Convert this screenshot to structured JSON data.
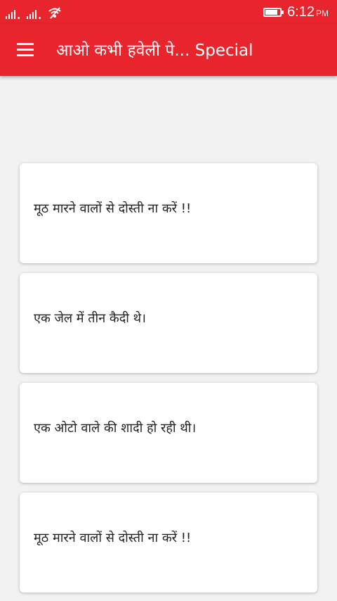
{
  "status_bar": {
    "time": "6:12",
    "ampm": "PM",
    "battery_level": 0.85,
    "icons": [
      "signal-icon",
      "signal-icon",
      "wifi-off-icon",
      "battery-icon"
    ]
  },
  "app_bar": {
    "title": "आओ कभी हवेली पे... Special",
    "background": "#e8242c",
    "menu_icon": "hamburger-menu-icon"
  },
  "cards": [
    {
      "text": "मूठ मारने वालों से दोस्ती ना करें !!"
    },
    {
      "text": "एक जेल में तीन कैदी थे।"
    },
    {
      "text": "एक ओटो वाले की शादी हो रही थी।"
    },
    {
      "text": "मूठ मारने वालों से दोस्ती ना करें !!"
    }
  ]
}
